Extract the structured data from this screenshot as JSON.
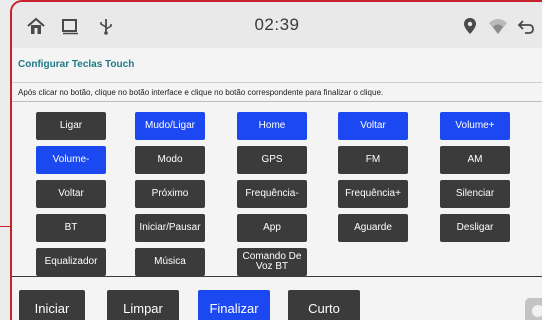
{
  "statusbar": {
    "time": "02:39",
    "icons": [
      "home-icon",
      "recent-apps-icon",
      "usb-icon",
      "location-icon",
      "wifi-icon",
      "back-icon"
    ]
  },
  "header": {
    "title": "Configurar Teclas Touch",
    "instruction": "Após clicar no botão, clique no botão interface e clique no botão correspondente para finalizar o clique."
  },
  "keys": [
    {
      "label": "Ligar",
      "selected": false
    },
    {
      "label": "Mudo/Ligar",
      "selected": true
    },
    {
      "label": "Home",
      "selected": true
    },
    {
      "label": "Voltar",
      "selected": true
    },
    {
      "label": "Volume+",
      "selected": true
    },
    {
      "label": "Volume-",
      "selected": true
    },
    {
      "label": "Modo",
      "selected": false
    },
    {
      "label": "GPS",
      "selected": false
    },
    {
      "label": "FM",
      "selected": false
    },
    {
      "label": "AM",
      "selected": false
    },
    {
      "label": "Voltar",
      "selected": false
    },
    {
      "label": "Próximo",
      "selected": false
    },
    {
      "label": "Frequência-",
      "selected": false
    },
    {
      "label": "Frequência+",
      "selected": false
    },
    {
      "label": "Silenciar",
      "selected": false
    },
    {
      "label": "BT",
      "selected": false
    },
    {
      "label": "Iniciar/Pausar",
      "selected": false
    },
    {
      "label": "App",
      "selected": false
    },
    {
      "label": "Aguarde",
      "selected": false
    },
    {
      "label": "Desligar",
      "selected": false
    },
    {
      "label": "Equalizador",
      "selected": false
    },
    {
      "label": "Música",
      "selected": false
    },
    {
      "label": "Comando De Voz BT",
      "selected": false
    }
  ],
  "actions": {
    "start": "Iniciar",
    "clear": "Limpar",
    "finish": "Finalizar",
    "short": "Curto"
  },
  "colors": {
    "accent": "#1b48f0",
    "key_dark": "#3b3b3b",
    "title": "#1f7a86",
    "frame": "#c8202c"
  }
}
